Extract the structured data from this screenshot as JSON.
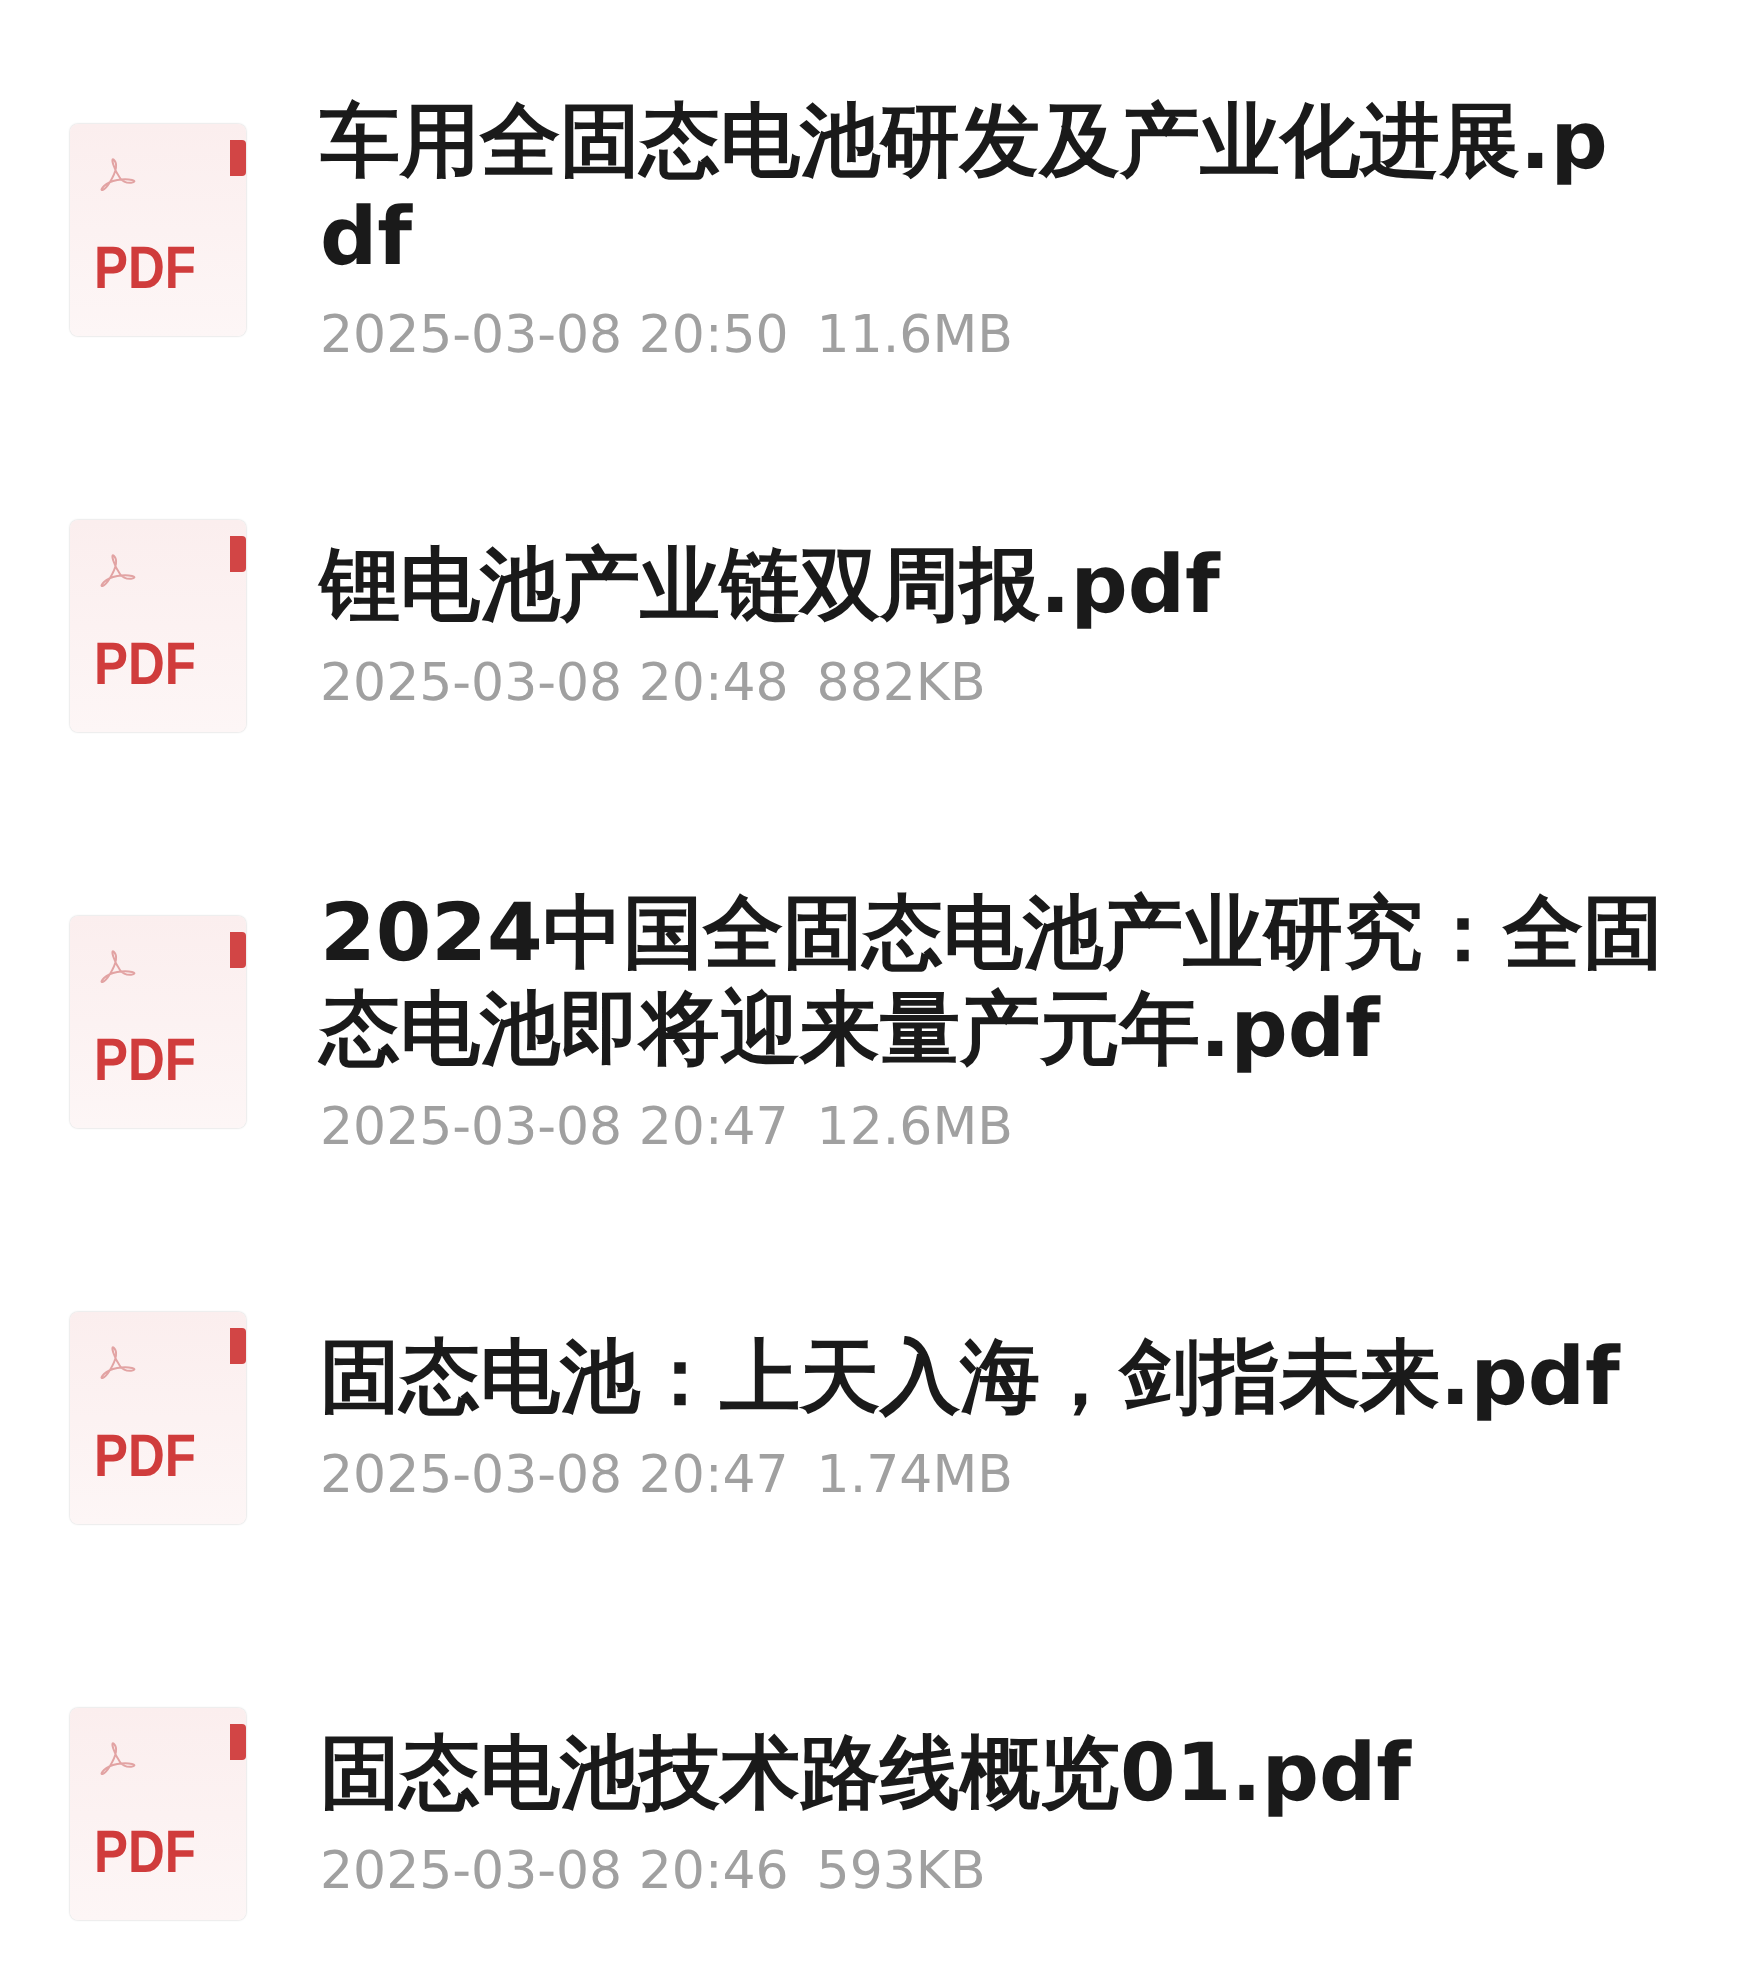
{
  "files": [
    {
      "badge": "PDF",
      "name": "车用全固态电池研发及产业化进展.pdf",
      "date": "2025-03-08 20:50",
      "size": "11.6MB"
    },
    {
      "badge": "PDF",
      "name": "锂电池产业链双周报.pdf",
      "date": "2025-03-08 20:48",
      "size": "882KB"
    },
    {
      "badge": "PDF",
      "name": "2024中国全固态电池产业研究：全固态电池即将迎来量产元年.pdf",
      "date": "2025-03-08 20:47",
      "size": "12.6MB"
    },
    {
      "badge": "PDF",
      "name": "固态电池：上天入海，剑指未来.pdf",
      "date": "2025-03-08 20:47",
      "size": "1.74MB"
    },
    {
      "badge": "PDF",
      "name": "固态电池技术路线概览01.pdf",
      "date": "2025-03-08 20:46",
      "size": "593KB"
    }
  ]
}
